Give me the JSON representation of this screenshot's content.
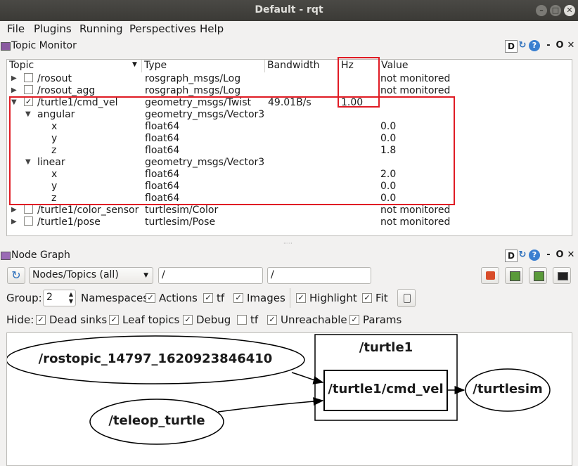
{
  "window": {
    "title": "Default - rqt"
  },
  "menu": [
    "File",
    "Plugins",
    "Running",
    "Perspectives",
    "Help"
  ],
  "topic_monitor": {
    "title": "Topic Monitor",
    "buttons": [
      "D",
      "O"
    ],
    "columns": [
      "Topic",
      "Type",
      "Bandwidth",
      "Hz",
      "Value"
    ],
    "rows": [
      {
        "topic": "/rosout",
        "type": "rosgraph_msgs/Log",
        "bandwidth": "",
        "hz": "",
        "value": "not monitored"
      },
      {
        "topic": "/rosout_agg",
        "type": "rosgraph_msgs/Log",
        "bandwidth": "",
        "hz": "",
        "value": "not monitored"
      },
      {
        "topic": "/turtle1/cmd_vel",
        "type": "geometry_msgs/Twist",
        "bandwidth": "49.01B/s",
        "hz": "1.00",
        "value": ""
      },
      {
        "topic": "angular",
        "type": "geometry_msgs/Vector3",
        "bandwidth": "",
        "hz": "",
        "value": ""
      },
      {
        "topic": "x",
        "type": "float64",
        "bandwidth": "",
        "hz": "",
        "value": "0.0"
      },
      {
        "topic": "y",
        "type": "float64",
        "bandwidth": "",
        "hz": "",
        "value": "0.0"
      },
      {
        "topic": "z",
        "type": "float64",
        "bandwidth": "",
        "hz": "",
        "value": "1.8"
      },
      {
        "topic": "linear",
        "type": "geometry_msgs/Vector3",
        "bandwidth": "",
        "hz": "",
        "value": ""
      },
      {
        "topic": "x",
        "type": "float64",
        "bandwidth": "",
        "hz": "",
        "value": "2.0"
      },
      {
        "topic": "y",
        "type": "float64",
        "bandwidth": "",
        "hz": "",
        "value": "0.0"
      },
      {
        "topic": "z",
        "type": "float64",
        "bandwidth": "",
        "hz": "",
        "value": "0.0"
      },
      {
        "topic": "/turtle1/color_sensor",
        "type": "turtlesim/Color",
        "bandwidth": "",
        "hz": "",
        "value": "not monitored"
      },
      {
        "topic": "/turtle1/pose",
        "type": "turtlesim/Pose",
        "bandwidth": "",
        "hz": "",
        "value": "not monitored"
      }
    ]
  },
  "node_graph": {
    "title": "Node Graph",
    "buttons": [
      "D",
      "O"
    ],
    "mode": "Nodes/Topics (all)",
    "filter1": "/",
    "filter2": "/",
    "group_label": "Group:",
    "group_value": "2",
    "group_options": [
      "Namespaces",
      "Actions",
      "tf",
      "Images",
      "Highlight",
      "Fit"
    ],
    "hide_label": "Hide:",
    "hide_options": [
      "Dead sinks",
      "Leaf topics",
      "Debug",
      "tf",
      "Unreachable",
      "Params"
    ],
    "nodes": {
      "rostopic": "/rostopic_14797_1620923846410",
      "teleop": "/teleop_turtle",
      "cluster": "/turtle1",
      "cmd_vel": "/turtle1/cmd_vel",
      "turtlesim": "/turtlesim"
    }
  }
}
